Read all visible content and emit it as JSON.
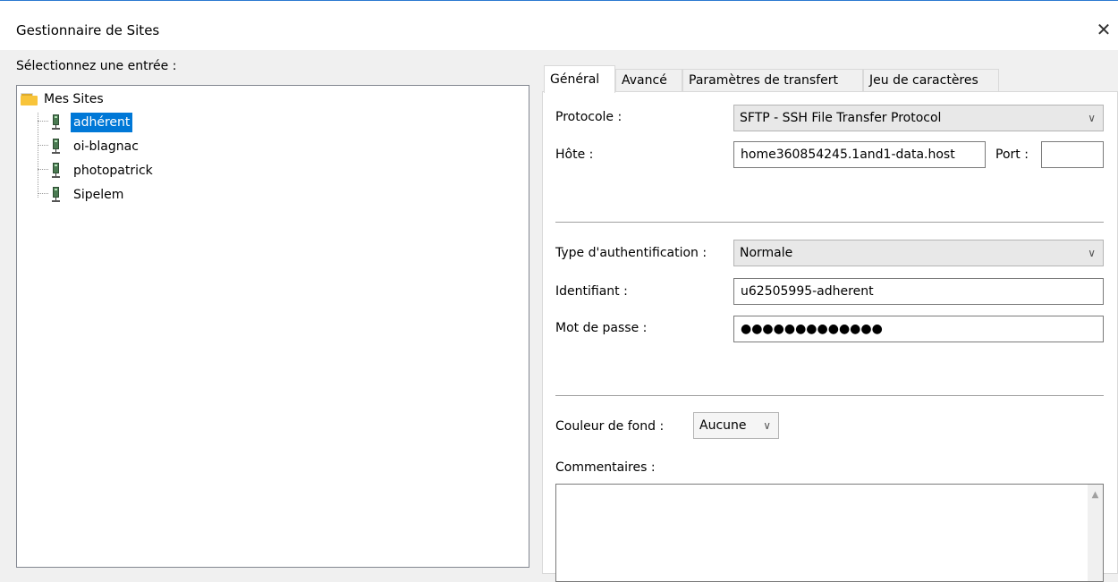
{
  "window": {
    "title": "Gestionnaire de Sites"
  },
  "tree": {
    "label": "Sélectionnez une entrée :",
    "root": "Mes Sites",
    "sites": [
      "adhérent",
      "oi-blagnac",
      "photopatrick",
      "Sipelem"
    ],
    "selected_index": 0
  },
  "tabs": [
    "Général",
    "Avancé",
    "Paramètres de transfert",
    "Jeu de caractères"
  ],
  "general": {
    "protocol_label": "Protocole :",
    "protocol_value": "SFTP - SSH File Transfer Protocol",
    "host_label": "Hôte :",
    "host_value": "home360854245.1and1-data.host",
    "port_label": "Port :",
    "port_value": "",
    "auth_label": "Type d'authentification :",
    "auth_value": "Normale",
    "user_label": "Identifiant :",
    "user_value": "u62505995-adherent",
    "password_label": "Mot de passe :",
    "password_value": "●●●●●●●●●●●●●",
    "bg_color_label": "Couleur de fond :",
    "bg_color_value": "Aucune",
    "comments_label": "Commentaires :",
    "comments_value": ""
  },
  "icons": {
    "close": "close-icon",
    "folder": "folder-icon",
    "server": "server-icon",
    "dropdown": "chevron-down-icon",
    "scroll_up": "scroll-up-arrow-icon"
  },
  "colors": {
    "selection": "#0078d7",
    "window_border": "#2b79d0"
  }
}
